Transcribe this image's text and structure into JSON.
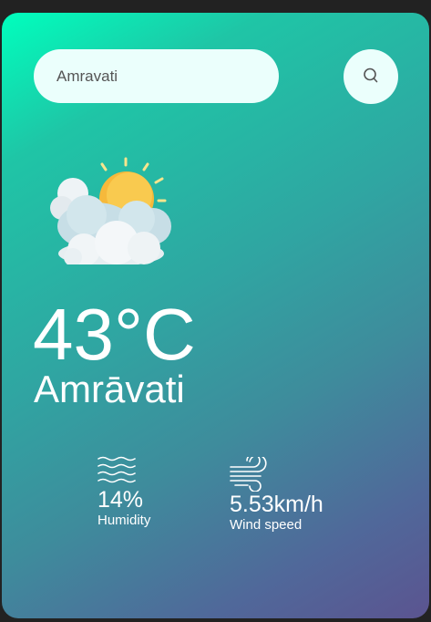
{
  "search": {
    "value": "Amravati",
    "icon": "search-icon"
  },
  "weather": {
    "icon": "partly-cloudy-sun-icon",
    "temperature": "43°C",
    "city": "Amrāvati"
  },
  "details": {
    "humidity": {
      "icon": "humidity-waves-icon",
      "value": "14%",
      "label": "Humidity"
    },
    "wind": {
      "icon": "wind-icon",
      "value": "5.53km/h",
      "label": "Wind speed"
    }
  },
  "colors": {
    "background": "#222222",
    "gradient_start": "#00ffbd",
    "gradient_end": "#5b5490",
    "field_background": "#ebfffc",
    "text": "#ffffff"
  }
}
